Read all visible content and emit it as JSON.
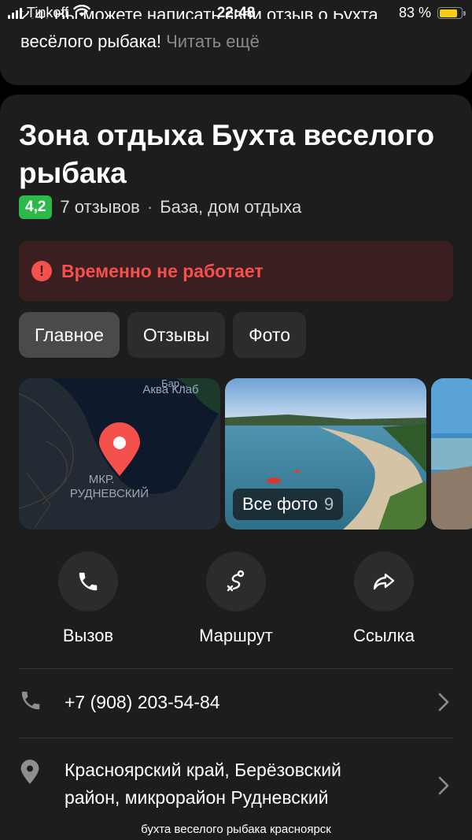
{
  "status_bar": {
    "carrier": "Tinkoff",
    "time": "22:48",
    "battery": "83 %",
    "battery_level": 0.83
  },
  "previous_card": {
    "line1": "2.4. Вы можете написать свой отзыв о Бухта",
    "line2": "весёлого рыбака!",
    "read_more": "Читать ещё"
  },
  "place": {
    "title": "Зона отдыха Бухта веселого рыбака",
    "rating": "4,2",
    "reviews": "7 отзывов",
    "separator": "·",
    "category": "База, дом отдыха"
  },
  "alert": {
    "text": "Временно не работает",
    "color": "#f4514d"
  },
  "tabs": [
    {
      "label": "Главное",
      "active": true
    },
    {
      "label": "Отзывы",
      "active": false
    },
    {
      "label": "Фото",
      "active": false
    }
  ],
  "map": {
    "label_top": "Аква Клаб",
    "label_top_cut": "Бар...",
    "district_line1": "МКР.",
    "district_line2": "РУДНЕВСКИЙ"
  },
  "photos": {
    "all_label": "Все фото",
    "count": "9"
  },
  "actions": [
    {
      "label": "Вызов",
      "icon": "phone-icon"
    },
    {
      "label": "Маршрут",
      "icon": "route-icon"
    },
    {
      "label": "Ссылка",
      "icon": "share-icon"
    }
  ],
  "contacts": {
    "phone": "+7 (908) 203-54-84",
    "address_line1": "Красноярский край, Берёзовский",
    "address_line2": "район, микрорайон Рудневский"
  },
  "caption": "бухта веселого рыбака красноярск",
  "colors": {
    "background": "#1d1d1d",
    "rating_green": "#2db84a",
    "alert_bg": "#3b1e20"
  }
}
